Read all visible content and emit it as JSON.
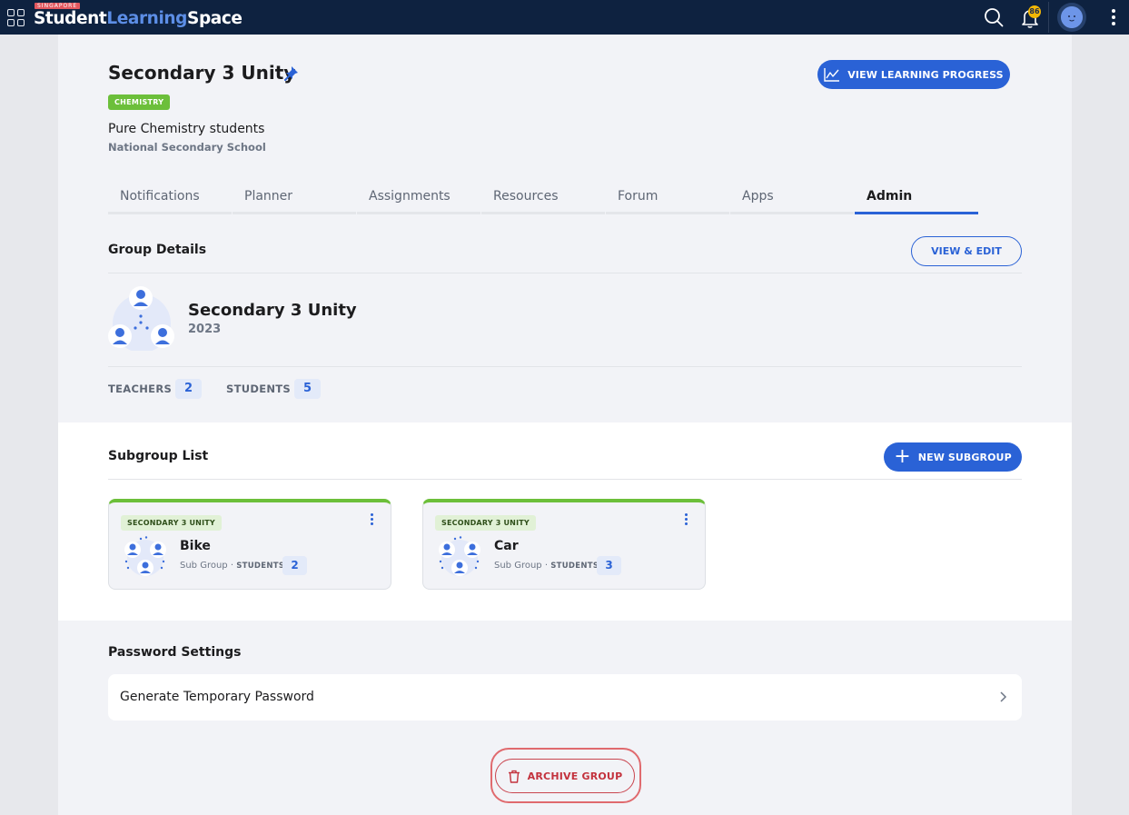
{
  "topbar": {
    "logo_country": "SINGAPORE",
    "logo_word1": "Student",
    "logo_word2": "Learning",
    "logo_word3": "Space",
    "notification_count": "86",
    "icons": [
      "apps-grid-icon",
      "search-icon",
      "bell-icon",
      "avatar",
      "more-vertical-icon"
    ]
  },
  "header": {
    "title": "Secondary 3 Unity",
    "pinned": true,
    "subject_tag": "CHEMISTRY",
    "description": "Pure Chemistry students",
    "school": "National Secondary School",
    "view_progress_label": "VIEW LEARNING PROGRESS"
  },
  "tabs": [
    {
      "label": "Notifications",
      "active": false
    },
    {
      "label": "Planner",
      "active": false
    },
    {
      "label": "Assignments",
      "active": false
    },
    {
      "label": "Resources",
      "active": false
    },
    {
      "label": "Forum",
      "active": false
    },
    {
      "label": "Apps",
      "active": false
    },
    {
      "label": "Admin",
      "active": true
    }
  ],
  "group_details": {
    "section_title": "Group Details",
    "view_edit_label": "VIEW & EDIT",
    "name": "Secondary 3 Unity",
    "year": "2023",
    "teachers_label": "TEACHERS",
    "teachers_count": "2",
    "students_label": "STUDENTS",
    "students_count": "5"
  },
  "subgroups": {
    "section_title": "Subgroup List",
    "new_label": "NEW SUBGROUP",
    "items": [
      {
        "parent_tag": "SECONDARY 3 UNITY",
        "name": "Bike",
        "type": "Sub Group",
        "students_label": "STUDENTS",
        "students_count": "2"
      },
      {
        "parent_tag": "SECONDARY 3 UNITY",
        "name": "Car",
        "type": "Sub Group",
        "students_label": "STUDENTS",
        "students_count": "3"
      }
    ]
  },
  "password_settings": {
    "section_title": "Password Settings",
    "generate_label": "Generate Temporary Password"
  },
  "archive": {
    "label": "ARCHIVE GROUP"
  },
  "colors": {
    "topbar": "#0e2240",
    "primary": "#2a62d6",
    "subject_green": "#6cbf3a",
    "danger": "#c3323d",
    "badge": "#f2b705"
  }
}
